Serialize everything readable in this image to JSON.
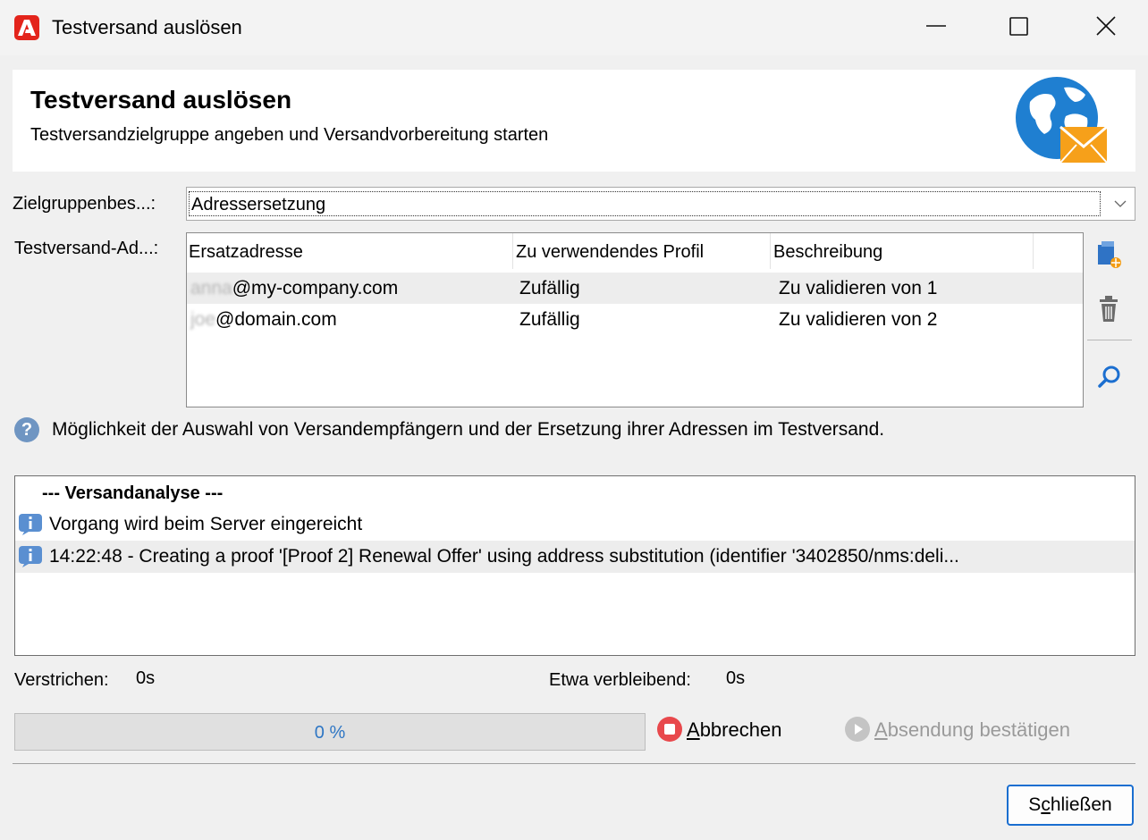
{
  "window": {
    "title": "Testversand auslösen"
  },
  "header": {
    "title": "Testversand auslösen",
    "subtitle": "Testversandzielgruppe angeben und Versandvorbereitung starten"
  },
  "form": {
    "target_label": "Zielgruppenbes...:",
    "target_value": "Adressersetzung",
    "addresses_label": "Testversand-Ad...:"
  },
  "grid": {
    "columns": [
      "Ersatzadresse",
      "Zu verwendendes Profil",
      "Beschreibung"
    ],
    "rows": [
      {
        "address_blurred": "anna",
        "address_domain": "@my-company.com",
        "profile": "Zufällig",
        "description": "Zu validieren von 1"
      },
      {
        "address_blurred": "joe",
        "address_domain": "@domain.com",
        "profile": "Zufällig",
        "description": "Zu validieren von 2"
      }
    ]
  },
  "help": {
    "text": "Möglichkeit der Auswahl von Versandempfängern und der Ersetzung ihrer Adressen im Testversand."
  },
  "log": {
    "title": "--- Versandanalyse ---",
    "entries": [
      "Vorgang wird beim Server eingereicht",
      "14:22:48 - Creating a proof '[Proof 2] Renewal Offer' using address substitution (identifier '3402850/nms:deli..."
    ]
  },
  "status": {
    "elapsed_label": "Verstrichen:",
    "elapsed_value": "0s",
    "remaining_label": "Etwa verbleibend:",
    "remaining_value": "0s"
  },
  "progress": {
    "value": 0,
    "text": "0 %"
  },
  "actions": {
    "cancel_label_accel": "A",
    "cancel_label_rest": "bbrechen",
    "confirm_label_accel": "A",
    "confirm_label_rest": "bsendung bestätigen",
    "close_label_pre": "S",
    "close_label_accel": "c",
    "close_label_rest": "hließen"
  },
  "colors": {
    "accent": "#1a6ed0",
    "app_icon": "#e3241b",
    "stop": "#e8484c",
    "info": "#4f86c6"
  },
  "icons": [
    "adobe-app-icon",
    "globe-mail-icon",
    "add-icon",
    "delete-icon",
    "search-icon",
    "help-icon",
    "info-icon",
    "stop-icon",
    "play-icon"
  ]
}
